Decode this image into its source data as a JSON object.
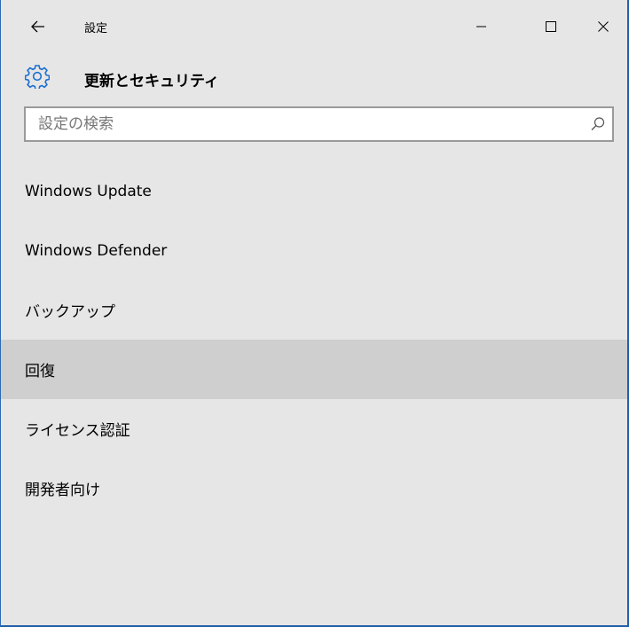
{
  "window": {
    "title": "設定",
    "minimize_icon": "minimize-icon",
    "maximize_icon": "maximize-icon",
    "close_icon": "close-icon",
    "back_icon": "back-arrow-icon"
  },
  "header": {
    "icon": "gear-icon",
    "title": "更新とセキュリティ",
    "icon_color": "#1a6fd1"
  },
  "search": {
    "placeholder": "設定の検索",
    "value": "",
    "icon": "search-icon"
  },
  "nav": {
    "items": [
      {
        "label": "Windows Update",
        "selected": false
      },
      {
        "label": "Windows Defender",
        "selected": false
      },
      {
        "label": "バックアップ",
        "selected": false
      },
      {
        "label": "回復",
        "selected": true
      },
      {
        "label": "ライセンス認証",
        "selected": false
      },
      {
        "label": "開発者向け",
        "selected": false
      }
    ]
  },
  "colors": {
    "background": "#e6e6e6",
    "selected_item": "#cfcfcf",
    "accent": "#1a6fd1"
  }
}
